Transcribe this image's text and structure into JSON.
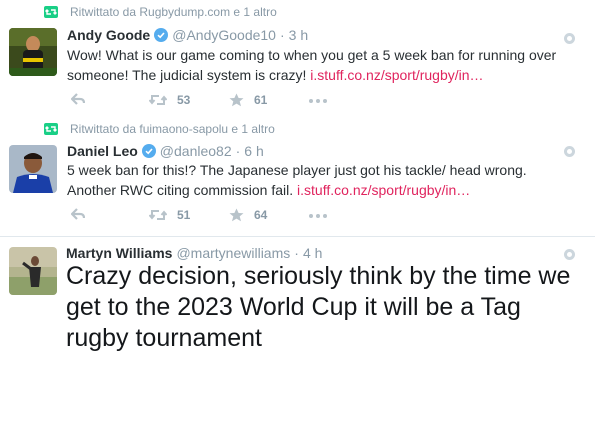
{
  "tweets": [
    {
      "retweet_label": "Ritwittato da Rugbydump.com e 1 altro",
      "name": "Andy Goode",
      "handle": "@AndyGoode10",
      "time": "3 h",
      "text": "Wow! What is our game coming to when you get a 5 week ban for running over someone! The judicial system is crazy!",
      "link": "i.stuff.co.nz/sport/rugby/in…",
      "retweets": "53",
      "likes": "61",
      "verified": true
    },
    {
      "retweet_label": "Ritwittato da fuimaono-sapolu e 1 altro",
      "name": "Daniel Leo",
      "handle": "@danleo82",
      "time": "6 h",
      "text": "5 week ban for this!? The Japanese player just got his tackle/ head wrong. Another RWC citing commission fail.",
      "link": "i.stuff.co.nz/sport/rugby/in…",
      "retweets": "51",
      "likes": "64",
      "verified": true
    },
    {
      "name": "Martyn Williams",
      "handle": "@martynewilliams",
      "time": "4 h",
      "text": "Crazy decision, seriously think by the time we get to the 2023 World Cup it will be a Tag rugby tournament",
      "verified": false
    }
  ],
  "colors": {
    "accent_link": "#e0245e",
    "retweet_green": "#19cf86",
    "verified_blue": "#55acee",
    "muted": "#8899a6"
  },
  "icons": [
    "retweet-icon",
    "verified-badge-icon",
    "reply-icon",
    "star-icon",
    "more-icon",
    "caret-icon"
  ]
}
